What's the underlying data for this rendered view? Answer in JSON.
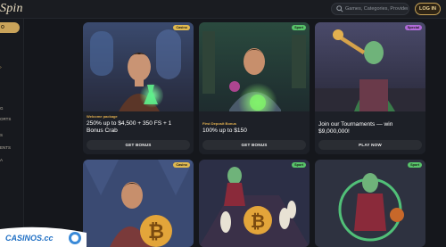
{
  "header": {
    "logo_text": "Spin",
    "search_placeholder": "Games, Categories, Providers",
    "login_label": "LOG IN"
  },
  "sidebar": {
    "active_label": "O",
    "items": [
      {
        "label": "",
        "arrow": "›"
      },
      {
        "label": "G",
        "arrow": ""
      },
      {
        "label": "ORTS",
        "arrow": ""
      },
      {
        "label": "S",
        "arrow": ""
      },
      {
        "label": "ENTS",
        "arrow": ""
      },
      {
        "label": "A",
        "arrow": ""
      }
    ]
  },
  "promos": [
    {
      "tag": "Casino",
      "small": "Welcome package",
      "title": "250% up to $4,500 + 350 FS + 1 Bonus Crab",
      "button": "GET BONUS"
    },
    {
      "tag": "Sport",
      "small": "First Deposit Bonus",
      "title": "100% up to $150",
      "button": "GET BONUS"
    },
    {
      "tag": "Special",
      "small": "",
      "title": "Join our Tournaments — win $9,000,000!",
      "button": "PLAY NOW"
    }
  ],
  "bottom_cards": [
    {
      "tag": "Casino"
    },
    {
      "tag": "Sport"
    },
    {
      "tag": "Sport"
    }
  ],
  "watermark": {
    "text": "CASINOS.cc"
  },
  "colors": {
    "accent_gold": "#c9a35a",
    "tag_casino": "#e0b94f",
    "tag_sport": "#58c46a",
    "tag_special": "#b06ad8"
  }
}
